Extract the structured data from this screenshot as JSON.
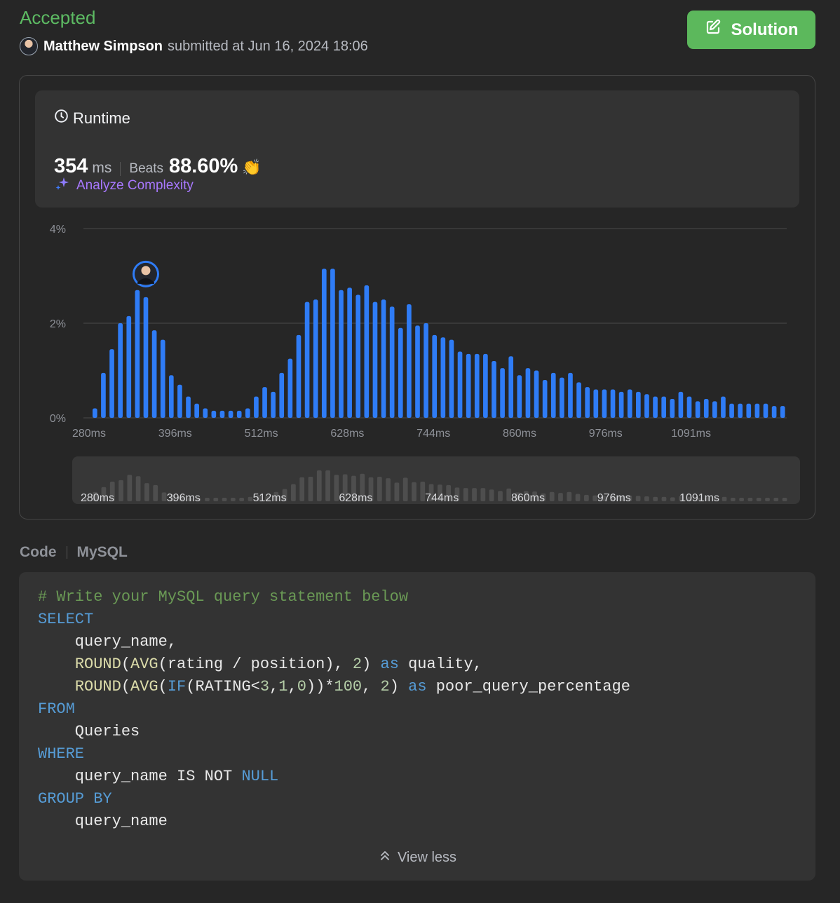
{
  "status": {
    "label": "Accepted",
    "color": "#5dbb63"
  },
  "submitter": {
    "name": "Matthew Simpson",
    "text": "submitted at Jun 16, 2024 18:06"
  },
  "solution_button": {
    "label": "Solution",
    "icon": "edit-icon"
  },
  "runtime": {
    "title": "Runtime",
    "value": "354",
    "unit": "ms",
    "beats_label": "Beats",
    "beats_value": "88.60%",
    "analyze_label": "Analyze Complexity"
  },
  "chart_data": {
    "type": "bar",
    "x_unit": "ms",
    "bar_color": "#2f7cf6",
    "y_ticks": [
      "4%",
      "2%",
      "0%"
    ],
    "ylim": [
      0,
      4
    ],
    "x_tick_labels": [
      "280ms",
      "396ms",
      "512ms",
      "628ms",
      "744ms",
      "860ms",
      "976ms",
      "1091ms"
    ],
    "x_tick_values": [
      280,
      396,
      512,
      628,
      744,
      860,
      976,
      1091
    ],
    "x_start": 280,
    "bin_width": 11.6,
    "values": [
      0.2,
      0.95,
      1.45,
      2.0,
      2.15,
      2.7,
      2.55,
      1.85,
      1.65,
      0.9,
      0.7,
      0.45,
      0.3,
      0.2,
      0.15,
      0.15,
      0.15,
      0.15,
      0.2,
      0.45,
      0.65,
      0.55,
      0.95,
      1.25,
      1.75,
      2.45,
      2.5,
      3.15,
      3.15,
      2.7,
      2.75,
      2.6,
      2.8,
      2.45,
      2.5,
      2.35,
      1.9,
      2.4,
      1.95,
      2.0,
      1.75,
      1.7,
      1.65,
      1.4,
      1.35,
      1.35,
      1.35,
      1.2,
      1.05,
      1.3,
      0.9,
      1.05,
      1.0,
      0.8,
      0.95,
      0.85,
      0.95,
      0.75,
      0.65,
      0.6,
      0.6,
      0.6,
      0.55,
      0.6,
      0.55,
      0.5,
      0.45,
      0.45,
      0.4,
      0.55,
      0.45,
      0.35,
      0.4,
      0.35,
      0.45,
      0.3,
      0.3,
      0.3,
      0.3,
      0.3,
      0.25,
      0.25
    ],
    "highlight_value": 354,
    "mini_labels": [
      "280ms",
      "396ms",
      "512ms",
      "628ms",
      "744ms",
      "860ms",
      "976ms",
      "1091ms"
    ]
  },
  "code_section": {
    "label": "Code",
    "language": "MySQL",
    "lines": [
      [
        {
          "t": "# Write your MySQL query statement below",
          "c": "comment"
        }
      ],
      [
        {
          "t": "SELECT",
          "c": "keyword"
        }
      ],
      [
        {
          "t": "    query_name,",
          "c": ""
        }
      ],
      [
        {
          "t": "    ",
          "c": ""
        },
        {
          "t": "ROUND",
          "c": "func"
        },
        {
          "t": "(",
          "c": ""
        },
        {
          "t": "AVG",
          "c": "func"
        },
        {
          "t": "(rating / position), ",
          "c": ""
        },
        {
          "t": "2",
          "c": "number"
        },
        {
          "t": ") ",
          "c": ""
        },
        {
          "t": "as",
          "c": "keyword"
        },
        {
          "t": " quality,",
          "c": ""
        }
      ],
      [
        {
          "t": "    ",
          "c": ""
        },
        {
          "t": "ROUND",
          "c": "func"
        },
        {
          "t": "(",
          "c": ""
        },
        {
          "t": "AVG",
          "c": "func"
        },
        {
          "t": "(",
          "c": ""
        },
        {
          "t": "IF",
          "c": "keyword"
        },
        {
          "t": "(RATING<",
          "c": ""
        },
        {
          "t": "3",
          "c": "number"
        },
        {
          "t": ",",
          "c": ""
        },
        {
          "t": "1",
          "c": "number"
        },
        {
          "t": ",",
          "c": ""
        },
        {
          "t": "0",
          "c": "number"
        },
        {
          "t": "))*",
          "c": ""
        },
        {
          "t": "100",
          "c": "number"
        },
        {
          "t": ", ",
          "c": ""
        },
        {
          "t": "2",
          "c": "number"
        },
        {
          "t": ") ",
          "c": ""
        },
        {
          "t": "as",
          "c": "keyword"
        },
        {
          "t": " poor_query_percentage",
          "c": ""
        }
      ],
      [
        {
          "t": "FROM",
          "c": "keyword"
        }
      ],
      [
        {
          "t": "    Queries",
          "c": ""
        }
      ],
      [
        {
          "t": "WHERE",
          "c": "keyword"
        }
      ],
      [
        {
          "t": "    query_name IS NOT ",
          "c": ""
        },
        {
          "t": "NULL",
          "c": "keyword"
        }
      ],
      [
        {
          "t": "GROUP BY",
          "c": "keyword"
        }
      ],
      [
        {
          "t": "    query_name",
          "c": ""
        }
      ]
    ],
    "view_less_label": "View less"
  }
}
